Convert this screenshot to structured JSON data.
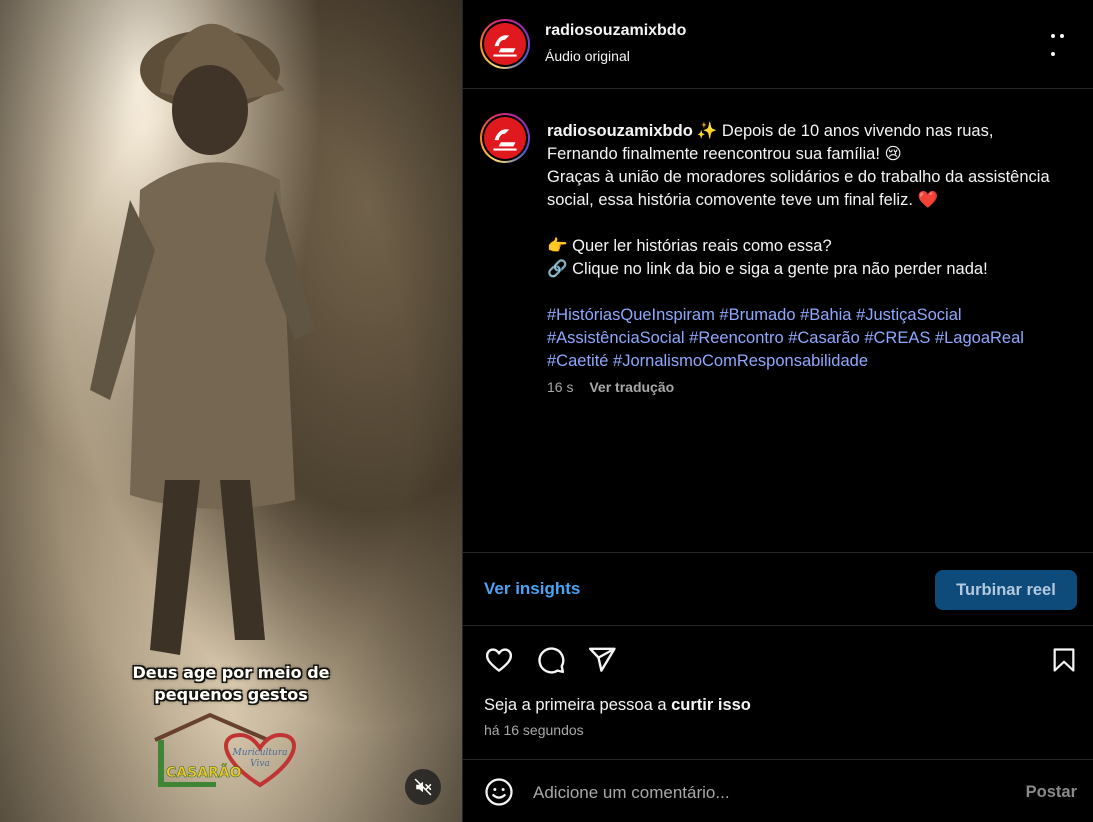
{
  "video": {
    "overlay_lines": [
      "Deus age por meio de",
      "pequenos gestos"
    ],
    "logo_word": "CASARÃO",
    "logo_script": [
      "Muricultura",
      "Viva"
    ],
    "mute_icon": "speaker-muted-icon"
  },
  "header": {
    "username": "radiosouzamixbdo",
    "audio": "Áudio original",
    "more_icon": "more-horizontal-icon"
  },
  "caption": {
    "username": "radiosouzamixbdo",
    "line1": "✨ Depois de 10 anos vivendo nas ruas, Fernando finalmente reencontrou sua família! 😢",
    "line2": "Graças à união de moradores solidários e do trabalho da assistência social, essa história comovente teve um final feliz. ❤️",
    "line3": "👉 Quer ler histórias reais como essa?",
    "line4": "🔗 Clique no link da bio e siga a gente pra não perder nada!",
    "hashtags": "#HistóriasQueInspiram #Brumado #Bahia #JustiçaSocial #AssistênciaSocial #Reencontro #Casarão #CREAS #LagoaReal #Caetité #JornalismoComResponsabilidade",
    "age": "16 s",
    "translate_label": "Ver tradução"
  },
  "insights": {
    "link_label": "Ver insights",
    "boost_label": "Turbinar reel"
  },
  "actions": {
    "icons": [
      "heart-icon",
      "comment-icon",
      "share-icon",
      "bookmark-icon"
    ]
  },
  "likes": {
    "prefix": "Seja a primeira pessoa a",
    "link": "curtir isso"
  },
  "timestamp": "há 16 segundos",
  "comment": {
    "placeholder": "Adicione um comentário...",
    "post_label": "Postar"
  },
  "colors": {
    "link_blue": "#4aa3f5",
    "hashtag_blue": "#8fa8ff",
    "boost_bg": "#0e4a7a",
    "avatar_red": "#e0191f"
  }
}
